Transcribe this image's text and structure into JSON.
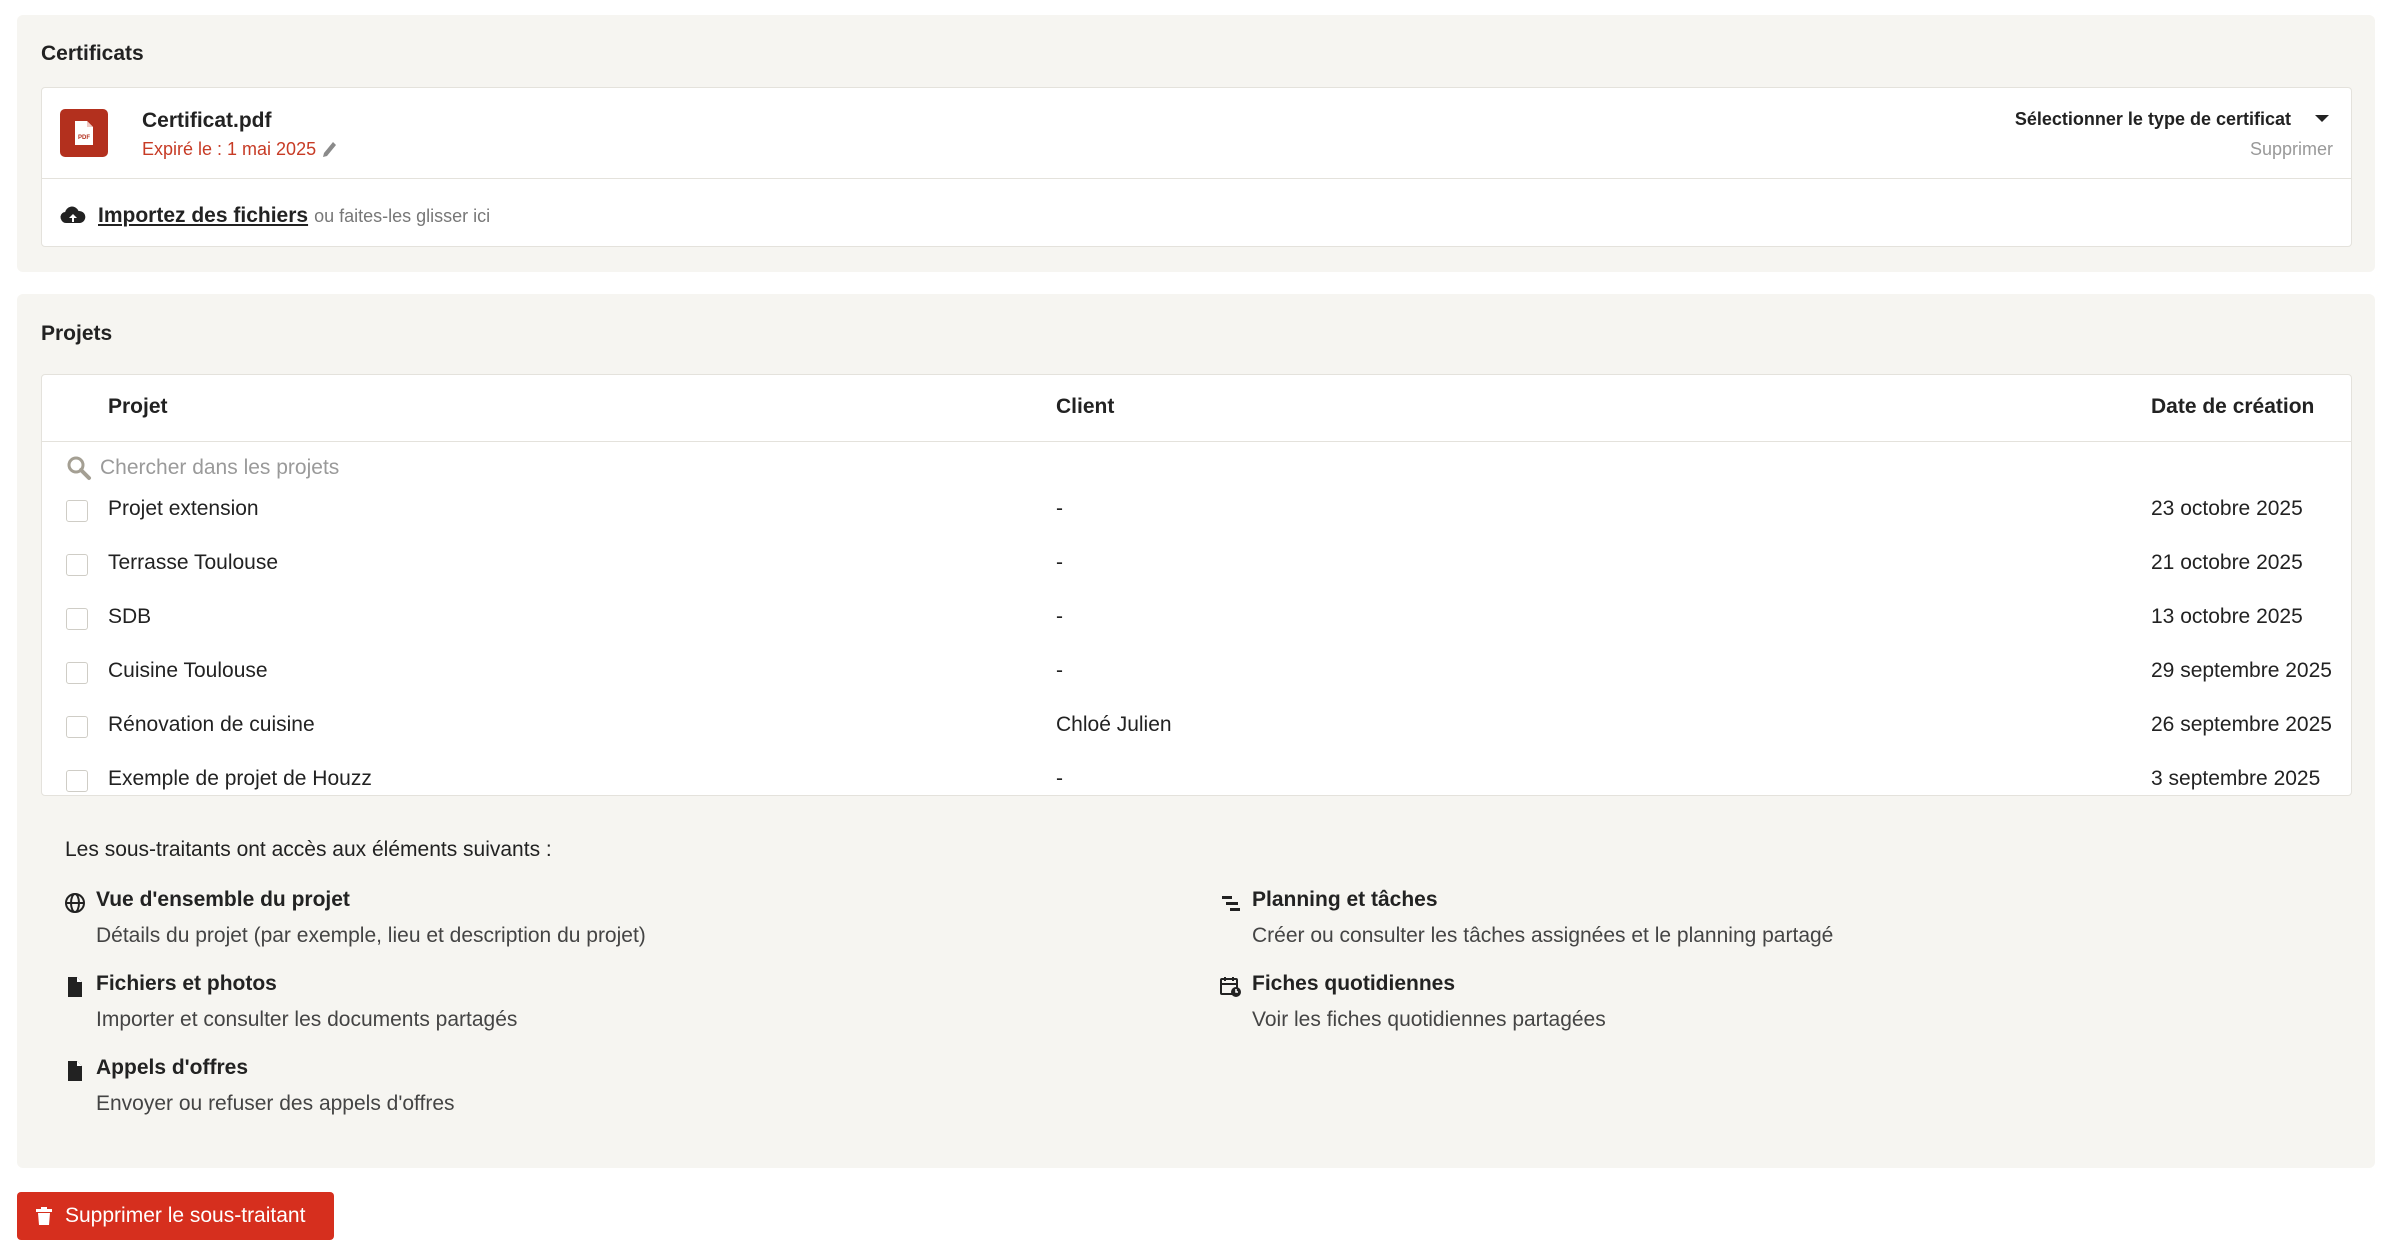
{
  "certificates": {
    "title": "Certificats",
    "file_name": "Certificat.pdf",
    "file_badge": "PDF",
    "expiry": "Expiré le : 1 mai 2025",
    "type_select": "Sélectionner le type de certificat",
    "delete_label": "Supprimer",
    "upload_link": "Importez des fichiers",
    "upload_hint": "ou faites-les glisser ici"
  },
  "projects": {
    "title": "Projets",
    "columns": {
      "project": "Projet",
      "client": "Client",
      "date": "Date de création"
    },
    "search_placeholder": "Chercher dans les projets",
    "rows": [
      {
        "project": "Projet extension",
        "client": "-",
        "date": "23 octobre 2025"
      },
      {
        "project": "Terrasse Toulouse",
        "client": "-",
        "date": "21 octobre 2025"
      },
      {
        "project": "SDB",
        "client": "-",
        "date": "13 octobre 2025"
      },
      {
        "project": "Cuisine Toulouse",
        "client": "-",
        "date": "29 septembre 2025"
      },
      {
        "project": "Rénovation de cuisine",
        "client": "Chloé Julien",
        "date": "26 septembre 2025"
      },
      {
        "project": "Exemple de projet de Houzz",
        "client": "-",
        "date": "3 septembre 2025"
      }
    ]
  },
  "access": {
    "intro": "Les sous-traitants ont accès aux éléments suivants :",
    "features": [
      {
        "icon": "globe-icon",
        "title": "Vue d'ensemble du projet",
        "desc": "Détails du projet (par exemple, lieu et description du projet)"
      },
      {
        "icon": "gantt-icon",
        "title": "Planning et tâches",
        "desc": "Créer ou consulter les tâches assignées et le planning partagé"
      },
      {
        "icon": "file-icon",
        "title": "Fichiers et photos",
        "desc": "Importer et consulter les documents partagés"
      },
      {
        "icon": "calendar-icon",
        "title": "Fiches quotidiennes",
        "desc": "Voir les fiches quotidiennes partagées"
      },
      {
        "icon": "file-icon",
        "title": "Appels d'offres",
        "desc": "Envoyer ou refuser des appels d'offres"
      }
    ]
  },
  "delete_button": "Supprimer le sous-traitant",
  "colors": {
    "danger": "#d62f1e",
    "expiry": "#c73b25",
    "pdf": "#b3301e",
    "panel": "#f6f5f1"
  }
}
